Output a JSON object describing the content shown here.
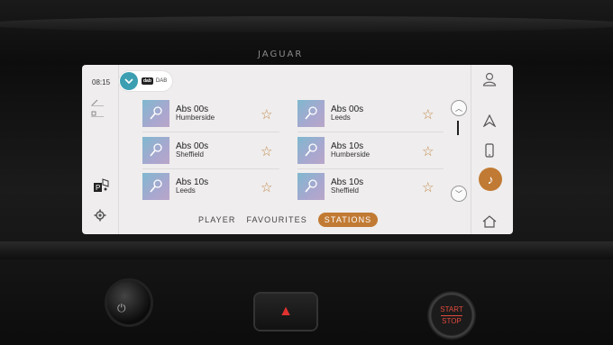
{
  "car": {
    "brand": "JAGUAR"
  },
  "status": {
    "time": "08:15"
  },
  "source": {
    "label": "DAB",
    "logo_text": "dab"
  },
  "stations": [
    {
      "name": "Abs 00s",
      "area": "Humberside"
    },
    {
      "name": "Abs 00s",
      "area": "Leeds"
    },
    {
      "name": "Abs 00s",
      "area": "Sheffield"
    },
    {
      "name": "Abs 10s",
      "area": "Humberside"
    },
    {
      "name": "Abs 10s",
      "area": "Leeds"
    },
    {
      "name": "Abs 10s",
      "area": "Sheffield"
    }
  ],
  "tabs": [
    {
      "label": "PLAYER",
      "active": false
    },
    {
      "label": "FAVOURITES",
      "active": false
    },
    {
      "label": "STATIONS",
      "active": true
    }
  ],
  "buttons": {
    "start": "START",
    "stop": "STOP"
  },
  "colors": {
    "accent": "#c17a33",
    "source_button": "#3b9fb1",
    "screen_bg": "#efeded"
  },
  "icons": {
    "thumb": "microphone-icon",
    "favorite": "star-outline-icon",
    "right_rail": [
      "profile-icon",
      "navigation-icon",
      "phone-icon",
      "media-icon",
      "home-icon"
    ]
  }
}
